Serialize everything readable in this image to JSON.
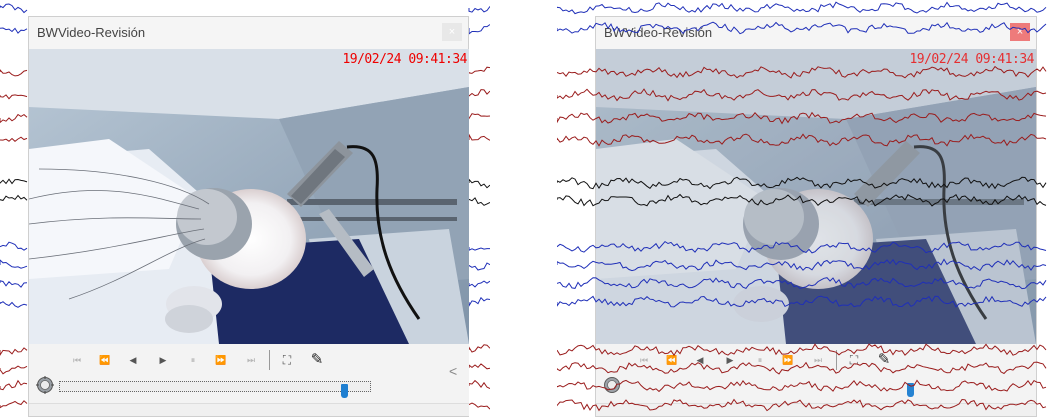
{
  "left_window": {
    "title": "BWVideo-Revisión",
    "close_label": "×",
    "timestamp": "19/02/24 09:41:34",
    "slider_position": 0.92
  },
  "right_window": {
    "title": "BWVideo-Revisión",
    "close_label": "×",
    "timestamp": "19/02/24 09:41:34",
    "slider_position": 0.92
  },
  "controls": {
    "first": "⏮",
    "rewind": "⏪",
    "step_back": "◀",
    "play": "▶",
    "pause": "⏸",
    "fast_forward": "⏩",
    "last": "⏭",
    "snapshot": "⛶",
    "annotate": "✎"
  },
  "side_arrow": "<",
  "colors": {
    "eeg_red": "#9a1c1c",
    "eeg_blue": "#1f2fb8",
    "eeg_black": "#111111",
    "timestamp": "#e00000",
    "slider_thumb": "#1f7fd1"
  }
}
